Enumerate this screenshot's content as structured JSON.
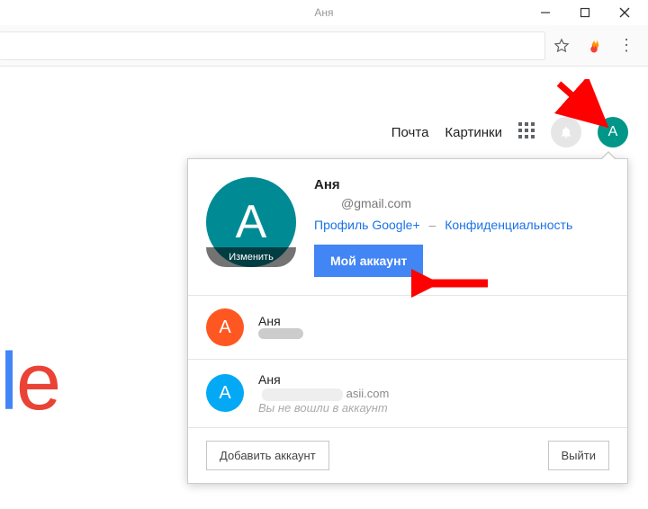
{
  "window": {
    "title": "Аня"
  },
  "topnav": {
    "mail": "Почта",
    "images": "Картинки",
    "avatar_letter": "A"
  },
  "account": {
    "avatar_letter": "А",
    "edit_label": "Изменить",
    "name": "Аня",
    "email": "@gmail.com",
    "profile_link": "Профиль Google+",
    "privacy_link": "Конфиденциальность",
    "my_account_btn": "Мой аккаунт"
  },
  "other_accounts": [
    {
      "letter": "A",
      "color": "#ff5722",
      "name": "Аня",
      "email": ""
    },
    {
      "letter": "A",
      "color": "#03a9f4",
      "name": "Аня",
      "email": "asii.com",
      "note": "Вы не вошли в аккаунт"
    }
  ],
  "footer": {
    "add_account": "Добавить аккаунт",
    "sign_out": "Выйти"
  },
  "logo_fragment": {
    "l": "l",
    "e": "e"
  }
}
